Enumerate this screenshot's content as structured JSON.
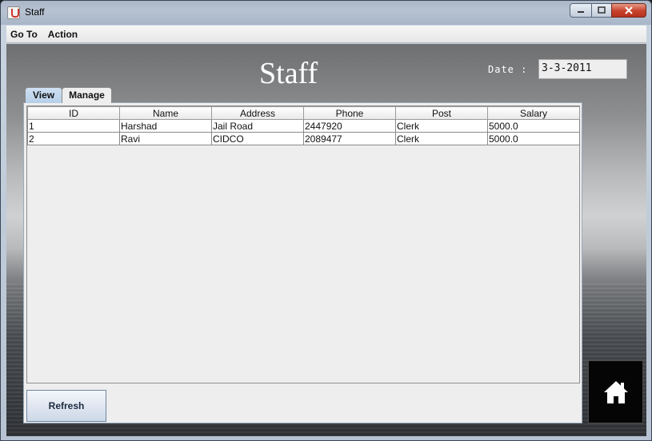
{
  "window": {
    "title": "Staff"
  },
  "menu": {
    "items": [
      "Go To",
      "Action"
    ]
  },
  "page": {
    "heading": "Staff",
    "date_label": "Date :",
    "date_value": "3-3-2011"
  },
  "tabs": [
    "View",
    "Manage"
  ],
  "table": {
    "columns": [
      "ID",
      "Name",
      "Address",
      "Phone",
      "Post",
      "Salary"
    ],
    "rows": [
      [
        "1",
        "Harshad",
        "Jail Road",
        "2447920",
        "Clerk",
        "5000.0"
      ],
      [
        "2",
        "Ravi",
        "CIDCO",
        "2089477",
        "Clerk",
        "5000.0"
      ]
    ]
  },
  "buttons": {
    "refresh": "Refresh",
    "home_icon": "home-icon"
  }
}
